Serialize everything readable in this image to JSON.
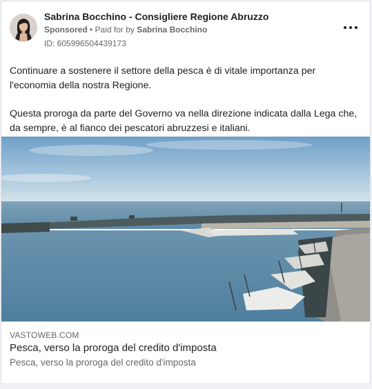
{
  "ad": {
    "advertiser_name": "Sabrina Bocchino - Consigliere Regione Abruzzo",
    "sponsored_label": "Sponsored",
    "separator": " • ",
    "paid_for_prefix": "Paid for by ",
    "paid_for_name": "Sabrina Bocchino",
    "ad_id": "ID: 605996504439173",
    "more_icon": "more-horizontal-icon"
  },
  "body": {
    "paragraphs": [
      "Continuare a sostenere il settore della pesca è di vitale importanza per l'economia della nostra Regione.",
      "Questa proroga da parte del Governo va nella direzione indicata dalla Lega che, da sempre, è al fianco dei pescatori abruzzesi e italiani."
    ]
  },
  "link": {
    "domain": "VASTOWEB.COM",
    "title": "Pesca, verso la proroga del credito d'imposta",
    "description": "Pesca, verso la proroga del credito d'imposta"
  },
  "colors": {
    "primary_text": "#1c1e21",
    "secondary_text": "#65676b",
    "border": "#dddfe2",
    "background": "#f0f2f5"
  }
}
